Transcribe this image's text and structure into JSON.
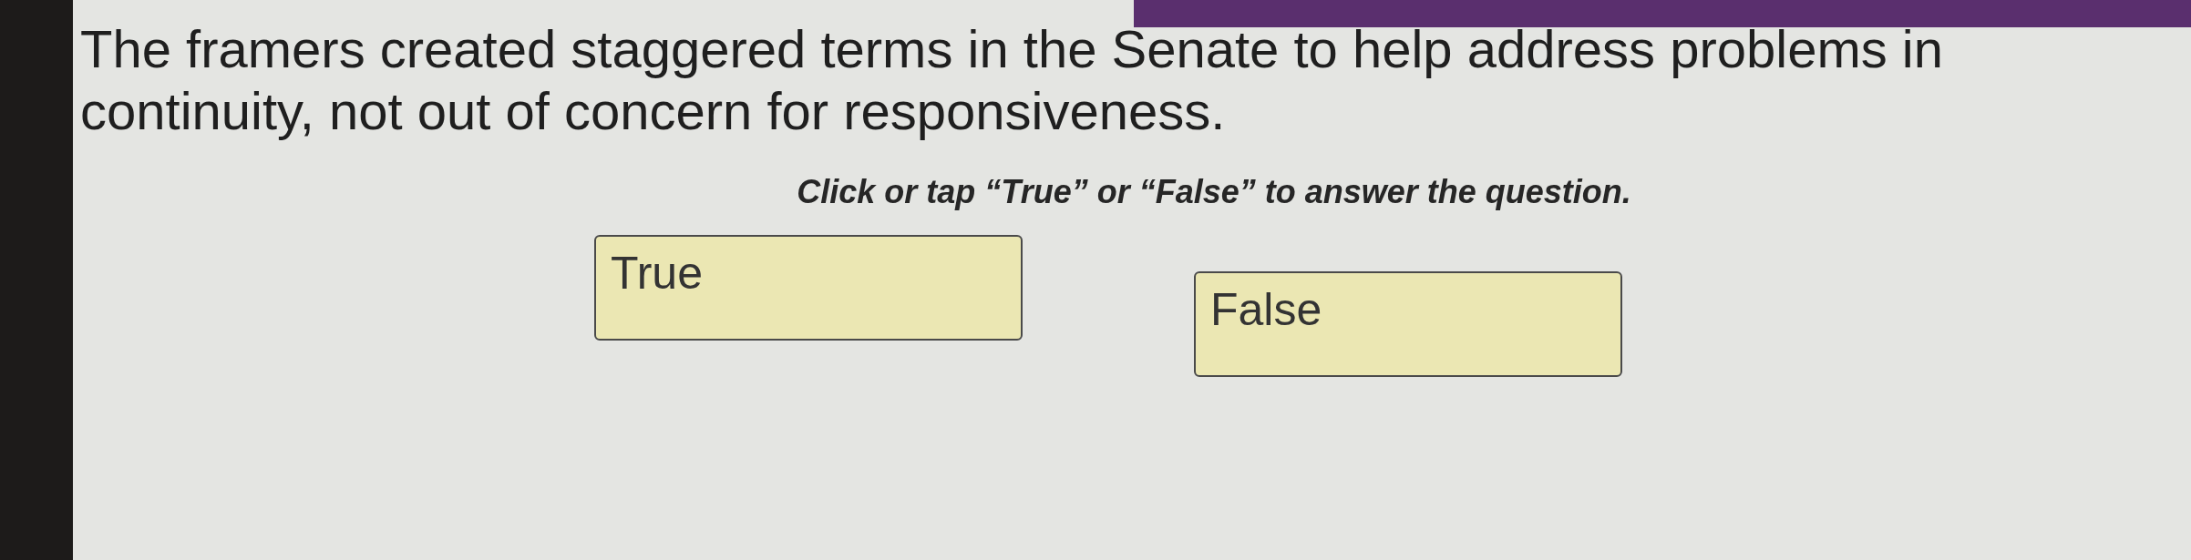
{
  "question": {
    "text": "The framers created staggered terms in the Senate to help address problems in continuity, not out of concern for responsiveness."
  },
  "instruction": {
    "text": "Click or tap “True” or “False” to answer the question."
  },
  "answers": [
    {
      "label": "True",
      "selected": false
    },
    {
      "label": "False",
      "selected": false
    }
  ]
}
